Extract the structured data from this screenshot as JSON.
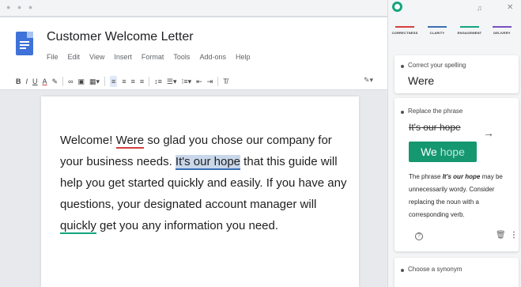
{
  "doc": {
    "title": "Customer Welcome Letter",
    "menu": [
      "File",
      "Edit",
      "View",
      "Insert",
      "Format",
      "Tools",
      "Add-ons",
      "Help"
    ],
    "body": {
      "t1": "Welcome! ",
      "spell_word": "Were",
      "t2": " so glad you chose our company for your business needs. ",
      "phrase": "It's our hope",
      "t3": " that this guide will help you get started quickly and easily. If you have any questions, your designated account manager will ",
      "synonym_word": "quickly",
      "t4": " get you any information you need."
    }
  },
  "panel": {
    "goals": [
      {
        "label": "CORRECTNESS",
        "color": "#d43f3f"
      },
      {
        "label": "CLARITY",
        "color": "#3b6fb6"
      },
      {
        "label": "ENGAGEMENT",
        "color": "#15a57e"
      },
      {
        "label": "DELIVERY",
        "color": "#7a4fc2"
      }
    ],
    "card1": {
      "category": "Correct your spelling",
      "suggestion": "Were"
    },
    "card2": {
      "category": "Replace the phrase",
      "original": "It's our hope",
      "replacement_main": "We",
      "replacement_rest": "hope",
      "explanation_pre": "The phrase ",
      "explanation_em": "It's our hope",
      "explanation_post": " may be unnecessarily wordy. Consider replacing the noun with a corresponding verb."
    },
    "card3": {
      "category": "Choose a synonym"
    }
  },
  "colors": {
    "accent_green": "#15976f",
    "doc_blue": "#3f72d8",
    "spelling_red": "#d43f3f",
    "clarity_blue": "#3b6fb6"
  }
}
